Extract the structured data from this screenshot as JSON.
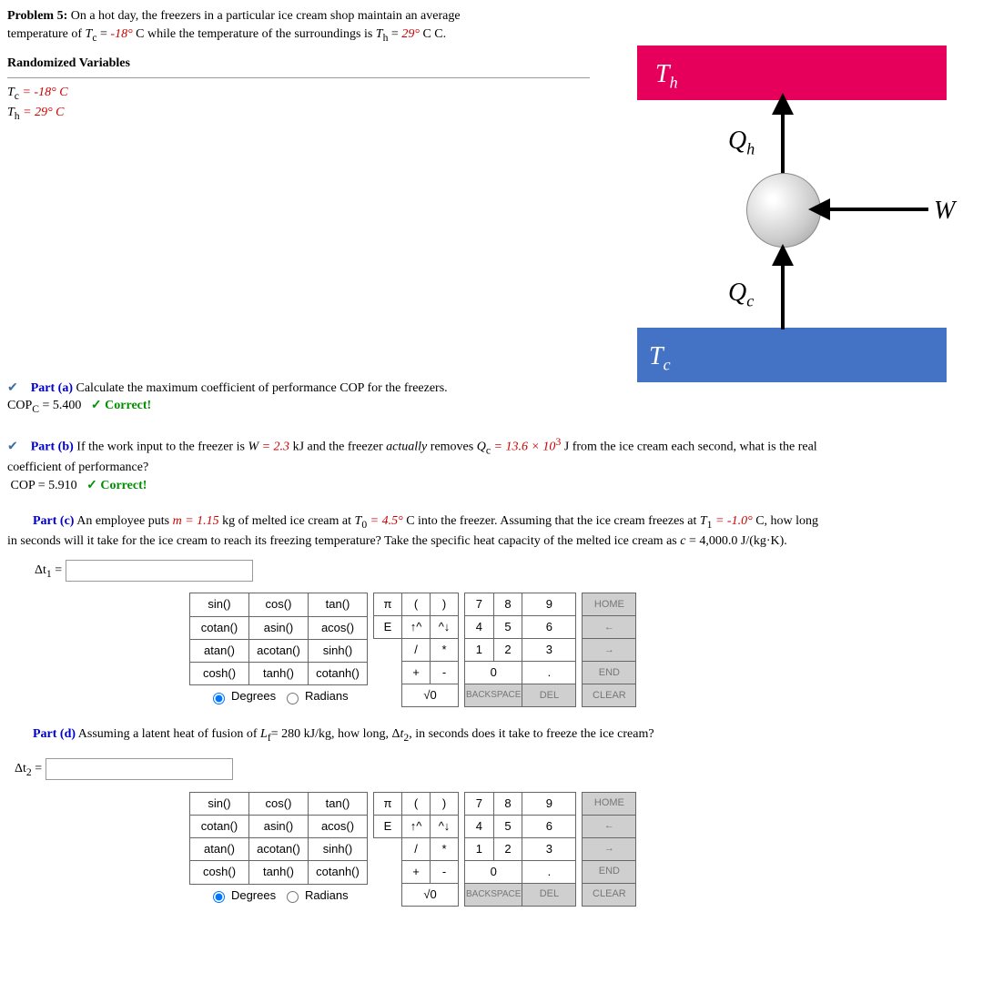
{
  "problem": {
    "number": "Problem 5:",
    "text1": "On a hot day, the freezers in a particular ice cream shop maintain an average",
    "text2_pre": "temperature of ",
    "tc_sym": "T",
    "tc_sub": "c",
    "eq": " = ",
    "tc_val": "-18°",
    "c": " C",
    "text2_mid": " while the temperature of the surroundings is ",
    "th_sym": "T",
    "th_sub": "h",
    "th_val": "29°",
    "text2_end": " C."
  },
  "randvar": {
    "title": "Randomized Variables",
    "line1": "T",
    "sub1": "c",
    "v1": " = -18° C",
    "line2": "T",
    "sub2": "h",
    "v2": " = 29° C"
  },
  "diagram": {
    "Th": "T",
    "Th_sub": "h",
    "Qh": "Q",
    "Qh_sub": "h",
    "W": "W",
    "Qc": "Q",
    "Qc_sub": "c",
    "Tc": "T",
    "Tc_sub": "c"
  },
  "partA": {
    "label": "Part (a)",
    "text": "Calculate the maximum coefficient of performance COP for the freezers.",
    "ans_label": "COP",
    "ans_sub": "C",
    "ans_val": " = 5.400",
    "correct": "✓ Correct!"
  },
  "partB": {
    "label": "Part (b)",
    "t1": "If the work input to the freezer is ",
    "W": "W",
    "Wv": " = 2.3",
    "t2": " kJ and the freezer ",
    "act": "actually",
    "t3": " removes ",
    "Qc": "Q",
    "Qcs": "c",
    "Qcv": " = 13.6 × 10",
    "exp": "3",
    "t4": " J from the ice cream each second, what is the real",
    "t5": "coefficient of performance?",
    "ans": "COP = 5.910",
    "correct": "✓ Correct!"
  },
  "partC": {
    "label": "Part (c)",
    "t1": "An employee puts ",
    "m": "m = 1.15",
    "t2": " kg of melted ice cream at ",
    "T0": "T",
    "T0s": "0",
    "T0v": " = 4.5°",
    "t3": " C into the freezer. Assuming that the ice cream freezes at ",
    "T1": "T",
    "T1s": "1",
    "T1v": " = -1.0°",
    "t4": " C, how long",
    "t5": "in seconds will it take for the ice cream to reach its freezing temperature? Take the specific heat capacity of the melted ice cream as ",
    "c": "c",
    "cv": " = 4,000.0 J/(kg·K).",
    "dt": "Δt",
    "dts": "1",
    "eq": " = "
  },
  "partD": {
    "label": "Part (d)",
    "t1": "Assuming a latent heat of fusion of ",
    "Lf": "L",
    "Lfs": "f",
    "Lfv": "= 280 kJ/kg, how long, Δ",
    "t2": "t",
    "t2s": "2",
    "t3": ", in seconds does it take to freeze the ice cream?",
    "dt": "Δt",
    "dts": "2",
    "eq": " = "
  },
  "kp": {
    "fn": [
      [
        "sin()",
        "cos()",
        "tan()"
      ],
      [
        "cotan()",
        "asin()",
        "acos()"
      ],
      [
        "atan()",
        "acotan()",
        "sinh()"
      ],
      [
        "cosh()",
        "tanh()",
        "cotanh()"
      ]
    ],
    "deg": "Degrees",
    "rad": "Radians",
    "sym": [
      [
        "π",
        "(",
        ")"
      ],
      [
        "E",
        "↑^",
        "^↓"
      ],
      [
        "",
        "/",
        "*"
      ],
      [
        "",
        "+",
        "-"
      ],
      [
        "",
        "",
        "√0"
      ]
    ],
    "num": [
      [
        "7",
        "8",
        "9"
      ],
      [
        "4",
        "5",
        "6"
      ],
      [
        "1",
        "2",
        "3"
      ],
      [
        "0",
        "",
        "."
      ],
      [
        "BACKSPACE",
        "",
        "DEL"
      ]
    ],
    "ctrl": [
      "HOME",
      "←",
      "→",
      "END",
      "CLEAR"
    ]
  }
}
